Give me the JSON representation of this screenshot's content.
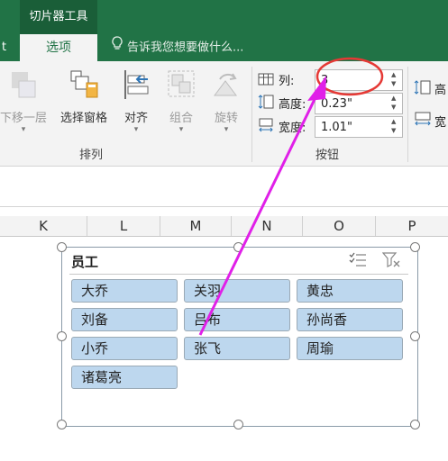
{
  "titlebar": {
    "context_tab": "切片器工具",
    "left_tab_fragment": "t"
  },
  "tabs": {
    "options": "选项"
  },
  "tell_me": {
    "placeholder": "告诉我您想要做什么..."
  },
  "ribbon": {
    "arrange": {
      "group_label": "排列",
      "send_backward": "下移一层",
      "selection_pane": "选择窗格",
      "align": "对齐",
      "group": "组合",
      "rotate": "旋转"
    },
    "buttons_group": {
      "group_label": "按钮",
      "columns_label": "列:",
      "columns_value": "3",
      "height_label": "高度:",
      "height_value": "0.23\"",
      "width_label": "宽度:",
      "width_value": "1.01\""
    },
    "size_group": {
      "height_label": "高",
      "width_label": "宽"
    }
  },
  "columns": [
    "K",
    "L",
    "M",
    "N",
    "O",
    "P"
  ],
  "slicer": {
    "title": "员工",
    "items": [
      "大乔",
      "关羽",
      "黄忠",
      "刘备",
      "吕布",
      "孙尚香",
      "小乔",
      "张飞",
      "周瑜",
      "诸葛亮"
    ]
  },
  "colors": {
    "excel_green": "#217346",
    "slicer_button": "#bdd7ee",
    "annotation_circle": "#e53935",
    "annotation_arrow": "#e020e8"
  },
  "icons": [
    "multi-select-icon",
    "clear-filter-icon",
    "lightbulb-icon"
  ]
}
